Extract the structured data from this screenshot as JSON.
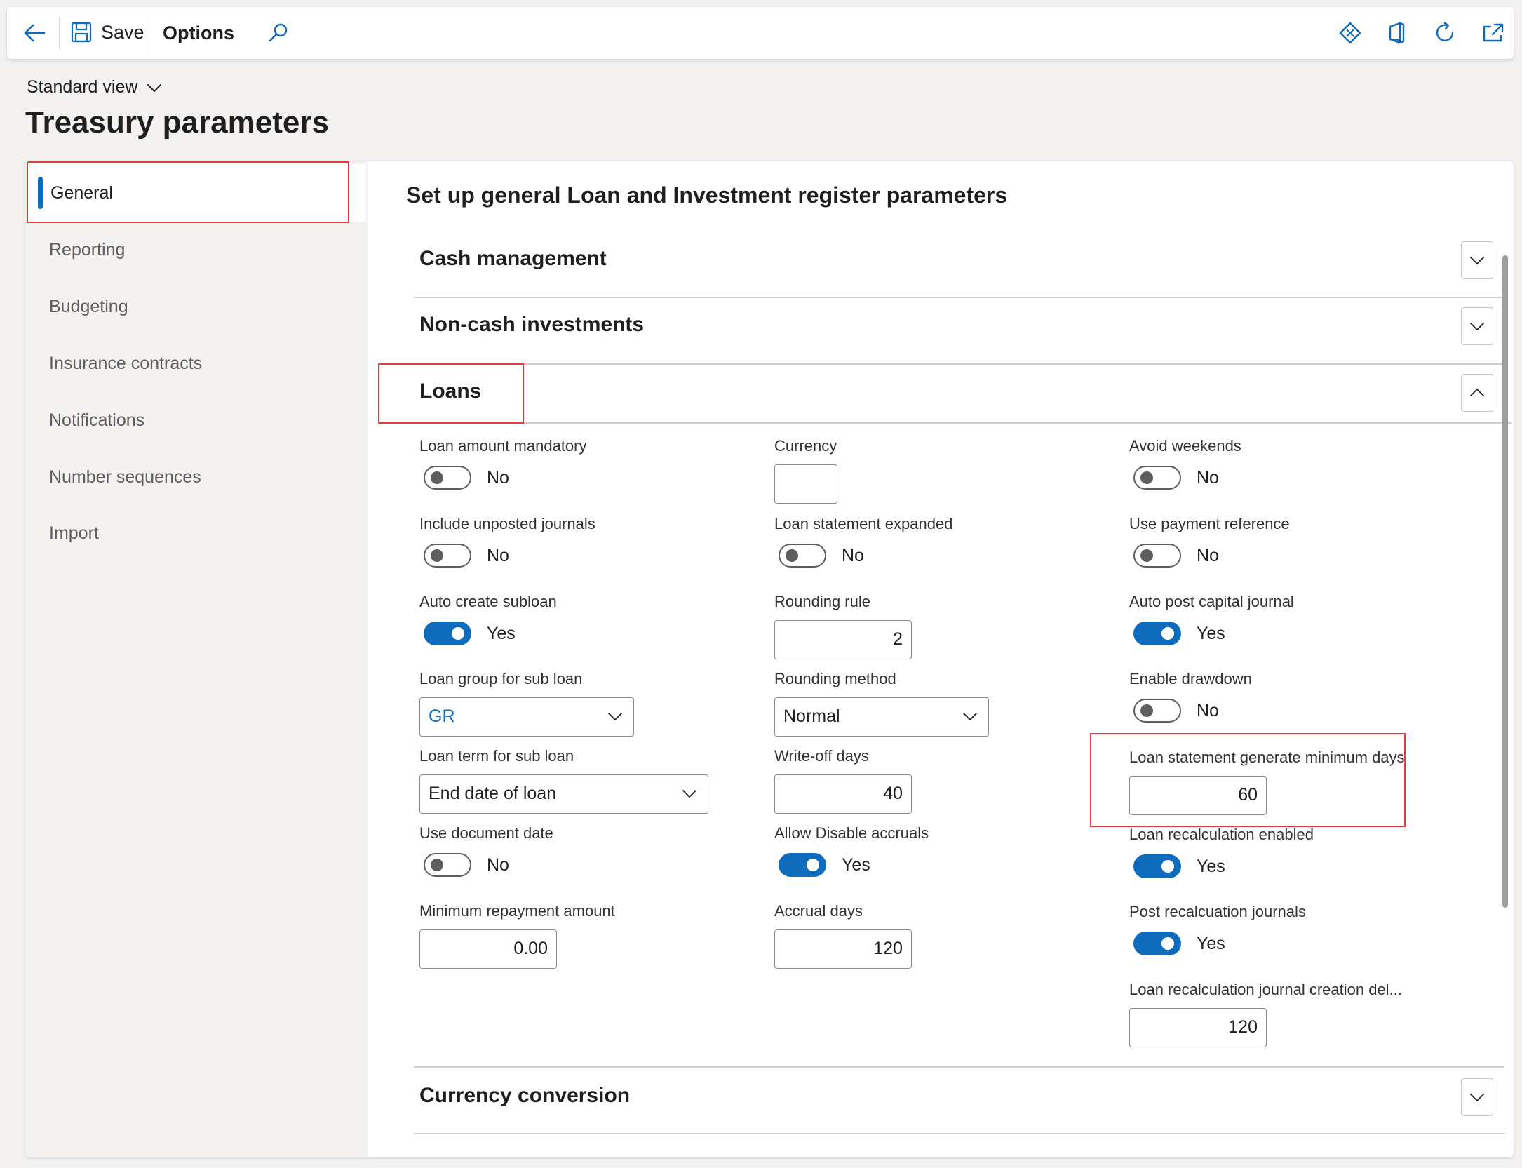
{
  "toolbar": {
    "save_label": "Save",
    "options_label": "Options"
  },
  "header": {
    "view_label": "Standard view",
    "title": "Treasury parameters"
  },
  "nav": {
    "items": [
      {
        "label": "General"
      },
      {
        "label": "Reporting"
      },
      {
        "label": "Budgeting"
      },
      {
        "label": "Insurance contracts"
      },
      {
        "label": "Notifications"
      },
      {
        "label": "Number sequences"
      },
      {
        "label": "Import"
      }
    ]
  },
  "content": {
    "heading": "Set up general Loan and Investment register parameters",
    "fasttabs": {
      "cash": "Cash management",
      "noncash": "Non-cash investments",
      "loans": "Loans",
      "currency": "Currency conversion"
    }
  },
  "loans": {
    "loan_amount_mandatory": {
      "label": "Loan amount mandatory",
      "value": "No"
    },
    "include_unposted_journals": {
      "label": "Include unposted journals",
      "value": "No"
    },
    "auto_create_subloan": {
      "label": "Auto create subloan",
      "value": "Yes"
    },
    "loan_group_sub_loan": {
      "label": "Loan group for sub loan",
      "value": "GR"
    },
    "loan_term_sub_loan": {
      "label": "Loan term for sub loan",
      "value": "End date of loan"
    },
    "use_document_date": {
      "label": "Use document date",
      "value": "No"
    },
    "minimum_repayment_amount": {
      "label": "Minimum repayment amount",
      "value": "0.00"
    },
    "currency": {
      "label": "Currency",
      "value": ""
    },
    "loan_statement_expanded": {
      "label": "Loan statement expanded",
      "value": "No"
    },
    "rounding_rule": {
      "label": "Rounding rule",
      "value": "2"
    },
    "rounding_method": {
      "label": "Rounding method",
      "value": "Normal"
    },
    "write_off_days": {
      "label": "Write-off days",
      "value": "40"
    },
    "allow_disable_accruals": {
      "label": "Allow Disable accruals",
      "value": "Yes"
    },
    "accrual_days": {
      "label": "Accrual days",
      "value": "120"
    },
    "avoid_weekends": {
      "label": "Avoid weekends",
      "value": "No"
    },
    "use_payment_reference": {
      "label": "Use payment reference",
      "value": "No"
    },
    "auto_post_capital_journal": {
      "label": "Auto post capital journal",
      "value": "Yes"
    },
    "enable_drawdown": {
      "label": "Enable drawdown",
      "value": "No"
    },
    "statement_min_days": {
      "label": "Loan statement generate minimum days",
      "value": "60"
    },
    "recalculation_enabled": {
      "label": "Loan recalculation enabled",
      "value": "Yes"
    },
    "post_recalculation_journals": {
      "label": "Post recalcuation journals",
      "value": "Yes"
    },
    "recalc_journal_delay": {
      "label": "Loan recalculation journal creation del...",
      "value": "120"
    }
  },
  "colors": {
    "accent": "#0f6cbd",
    "highlight_box": "#e23b3b"
  },
  "icons": {
    "back": "arrow-left-icon",
    "save": "floppy-disk-icon",
    "search": "search-icon",
    "diamond": "diamond-icon",
    "office": "office-icon",
    "refresh": "refresh-icon",
    "popout": "open-in-new-window-icon"
  }
}
